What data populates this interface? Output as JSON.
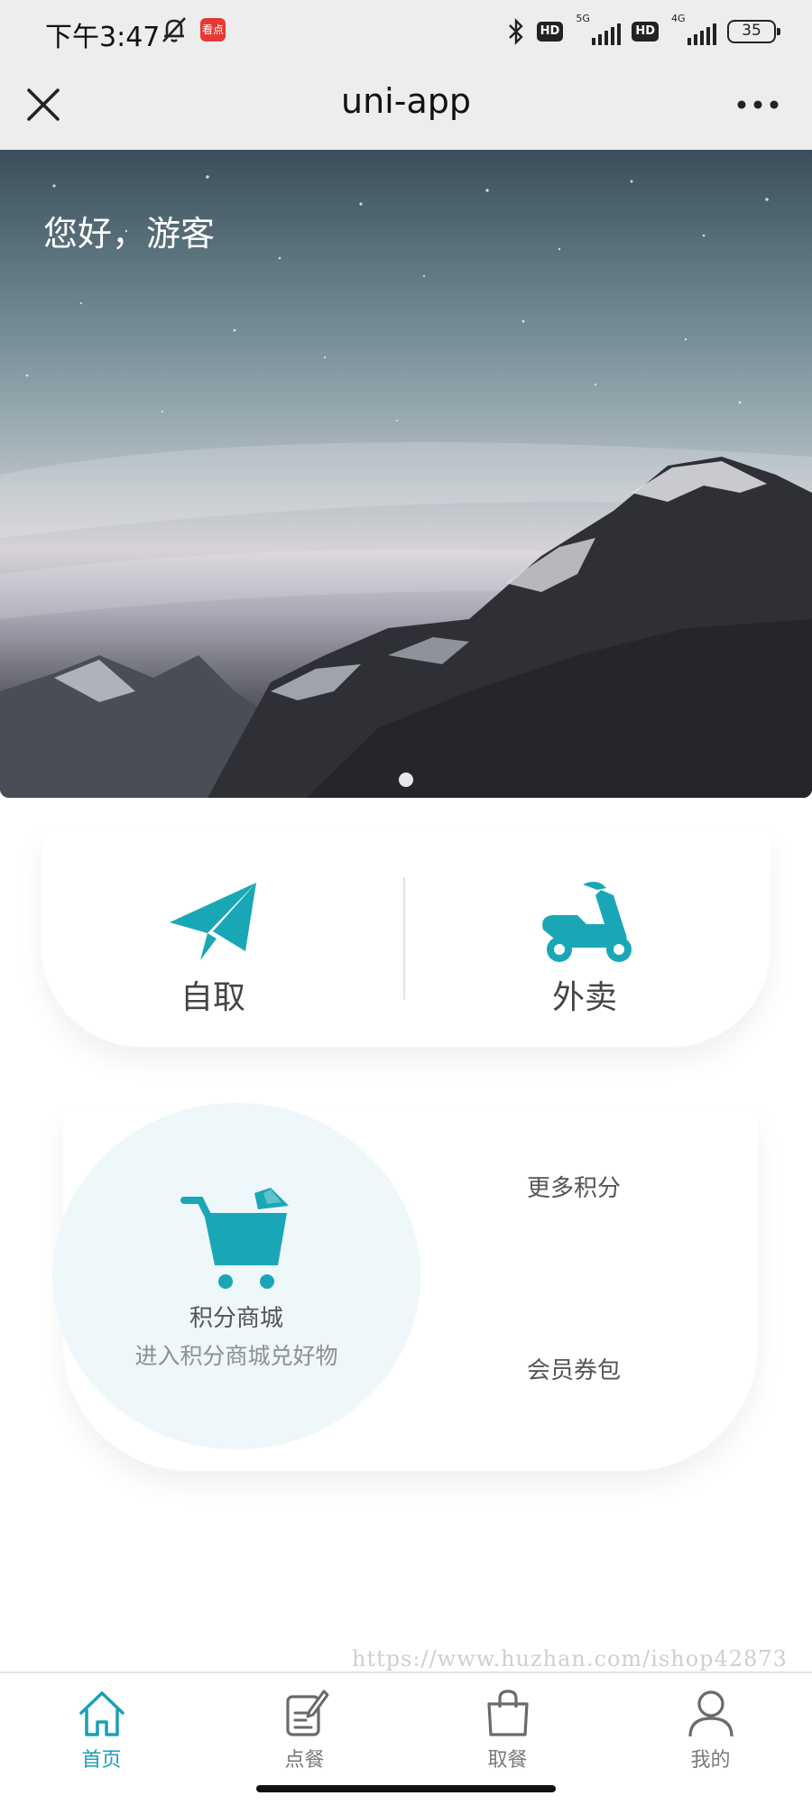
{
  "status_bar": {
    "time": "下午3:47",
    "app_badge": "看点",
    "hd_1": "HD",
    "network_1": "5G",
    "hd_2": "HD",
    "network_2": "4G",
    "battery": "35"
  },
  "nav": {
    "title": "uni-app",
    "close_icon": "close-icon",
    "more_icon": "more-dots-icon"
  },
  "banner": {
    "greeting": "您好，游客",
    "slide_count": 1,
    "active_slide": 1
  },
  "order": {
    "pickup_label": "自取",
    "pickup_icon": "paper-plane-icon",
    "delivery_label": "外卖",
    "delivery_icon": "scooter-icon"
  },
  "points": {
    "mall_title": "积分商城",
    "mall_subtitle": "进入积分商城兑好物",
    "mall_icon": "shopping-cart-icon",
    "more_points": "更多积分",
    "coupons": "会员券包"
  },
  "watermark": "https://www.huzhan.com/ishop42873",
  "tabs": [
    {
      "label": "首页",
      "icon": "home-icon",
      "active": true
    },
    {
      "label": "点餐",
      "icon": "order-note-icon",
      "active": false
    },
    {
      "label": "取餐",
      "icon": "shopping-bag-icon",
      "active": false
    },
    {
      "label": "我的",
      "icon": "user-icon",
      "active": false
    }
  ],
  "colors": {
    "accent": "#1aa7b5",
    "tab_active": "#1a9fb5",
    "mall_circle": "#eef7fa"
  }
}
